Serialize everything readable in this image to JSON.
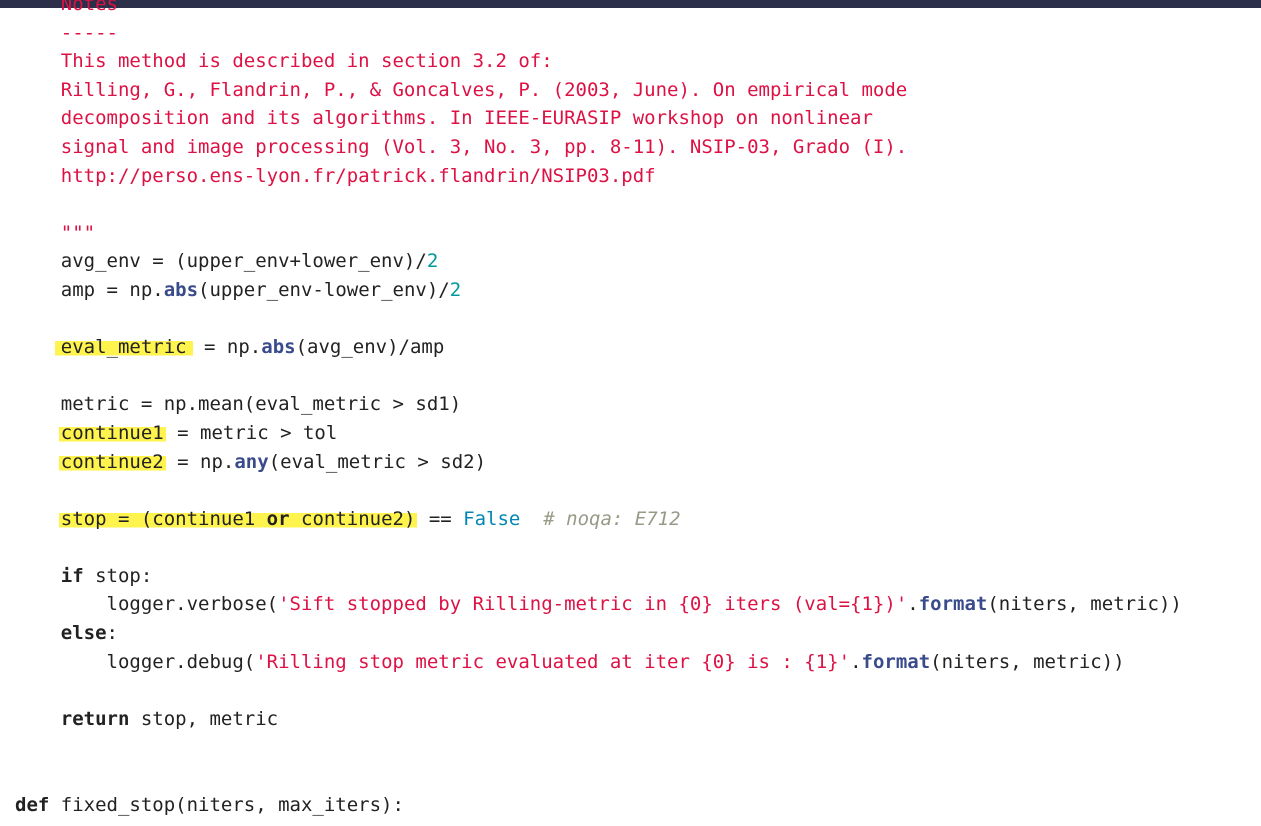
{
  "colors": {
    "topbar": "#2b2f4a",
    "string": "#dd1144",
    "function": "#3a4b8c",
    "number": "#009999",
    "constant": "#0086b3",
    "comment": "#999988",
    "highlight": "#fff34d"
  },
  "code": {
    "notes_heading": "Notes",
    "notes_rule": "-----",
    "doc_line1": "This method is described in section 3.2 of:",
    "doc_line2": "Rilling, G., Flandrin, P., & Goncalves, P. (2003, June). On empirical mode",
    "doc_line3": "decomposition and its algorithms. In IEEE-EURASIP workshop on nonlinear",
    "doc_line4": "signal and image processing (Vol. 3, No. 3, pp. 8-11). NSIP-03, Grado (I).",
    "doc_line5": "http://perso.ens-lyon.fr/patrick.flandrin/NSIP03.pdf",
    "doc_close": "\"\"\"",
    "avg_env": {
      "lhs": "avg_env = (upper_env+lower_env)/",
      "num": "2"
    },
    "amp": {
      "pre": "amp = np.",
      "fn": "abs",
      "post": "(upper_env-lower_env)/",
      "num": "2"
    },
    "eval_metric": {
      "var": "eval_metric",
      "pre": " = np.",
      "fn": "abs",
      "post": "(avg_env)/amp"
    },
    "metric_line": "metric = np.mean(eval_metric > sd1)",
    "continue1": {
      "var": "continue1",
      "post": " = metric > tol"
    },
    "continue2": {
      "var": "continue2",
      "pre": " = np.",
      "fn": "any",
      "post": "(eval_metric > sd2)"
    },
    "stop": {
      "a": "stop = (continue1 ",
      "or": "or",
      "b": " continue2)",
      "eq": " == ",
      "false": "False",
      "comment": "# noqa: E712"
    },
    "if_kw": "if",
    "if_rest": " stop:",
    "verbose": {
      "pre": "    logger.verbose(",
      "str": "'Sift stopped by Rilling-metric in {0} iters (val={1})'",
      "dot": ".",
      "fn": "format",
      "post": "(niters, metric))"
    },
    "else_kw": "else",
    "else_rest": ":",
    "debug": {
      "pre": "    logger.debug(",
      "str": "'Rilling stop metric evaluated at iter {0} is : {1}'",
      "dot": ".",
      "fn": "format",
      "post": "(niters, metric))"
    },
    "return_kw": "return",
    "return_rest": " stop, metric",
    "def_kw": "def",
    "def_rest": " fixed_stop(niters, max_iters):"
  }
}
